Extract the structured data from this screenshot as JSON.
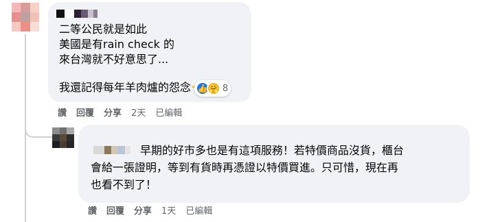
{
  "comment1": {
    "lines": [
      "二等公民就是如此",
      "美國是有rain check 的",
      "來台灣就不好意思了...",
      "我還記得每年羊肉爐的怨念"
    ],
    "emojis": [
      "pointing-hand",
      "laughing-face"
    ],
    "reactions": {
      "count": "8",
      "types": [
        "like-icon",
        "care-icon"
      ]
    },
    "actions": {
      "like": "讚",
      "reply": "回覆",
      "share": "分享",
      "time": "2天",
      "edited": "已編輯"
    }
  },
  "comment2": {
    "lines": [
      "早期的好市多也是有這項服務！若特價商品沒貨，櫃台",
      "會給一張證明，等到有貨時再憑證以特價買進。只可惜，現在再",
      "也看不到了！"
    ],
    "actions": {
      "like": "讚",
      "reply": "回覆",
      "share": "分享",
      "time": "1天",
      "edited": "已編輯"
    }
  },
  "colors": {
    "bubble": "#f0f2f5",
    "meta_text": "#65676b",
    "like_blue": "#1877f2",
    "thread_line": "#ced0d4"
  }
}
